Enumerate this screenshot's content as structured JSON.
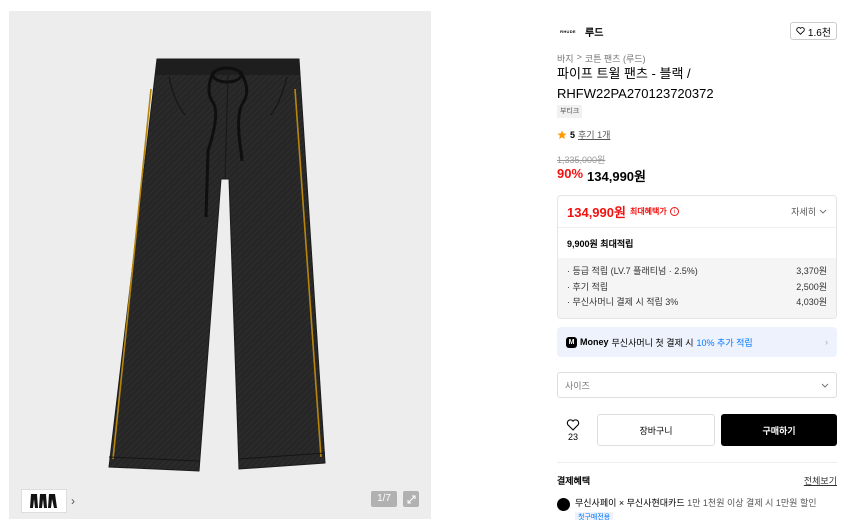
{
  "gallery": {
    "pager": "1/7",
    "thumbnail_icon": "pants-thumbnail",
    "next_icon": "chevron-right-icon",
    "expand_icon": "expand-icon"
  },
  "brand": {
    "logo_text": "RHUDE",
    "name": "루드",
    "like_count": "1.6천"
  },
  "breadcrumb": [
    "바지",
    ">",
    "코튼 팬츠 (루드)"
  ],
  "product": {
    "title": "파이프 트윌 팬츠 - 블랙 / RHFW22PA270123720372",
    "tag": "부티크",
    "rating": "5",
    "reviews": "후기 1개",
    "original_price": "1,335,000원",
    "discount": "90%",
    "price": "134,990원"
  },
  "benefit": {
    "max_price": "134,990원",
    "max_label": "최대혜택가",
    "detail_label": "자세히",
    "points_total": "9,900원 최대적립",
    "items": [
      {
        "label": "· 등급 적립 (LV.7 플래티넘 · 2.5%)",
        "value": "3,370원"
      },
      {
        "label": "· 후기 적립",
        "value": "2,500원"
      },
      {
        "label": "· 무신사머니 결제 시 적립 3%",
        "value": "4,030원"
      }
    ]
  },
  "money_banner": {
    "brand": "Money",
    "text": "무신사머니 첫 결제 시",
    "highlight": "10% 추가 적립"
  },
  "size_select": {
    "placeholder": "사이즈"
  },
  "actions": {
    "wish_count": "23",
    "cart_label": "장바구니",
    "buy_label": "구매하기"
  },
  "payment": {
    "title": "결제혜택",
    "view_all": "전체보기",
    "item_bold": "무신사페이 × 무신사현대카드",
    "item_text": "1만 1천원 이상 결제 시 1만원 할인",
    "item_badge": "첫구매전용"
  },
  "colors": {
    "accent_red": "#f31110",
    "accent_blue": "#0078ff",
    "pants": "#2a2a2a",
    "piping": "#b8860b"
  }
}
